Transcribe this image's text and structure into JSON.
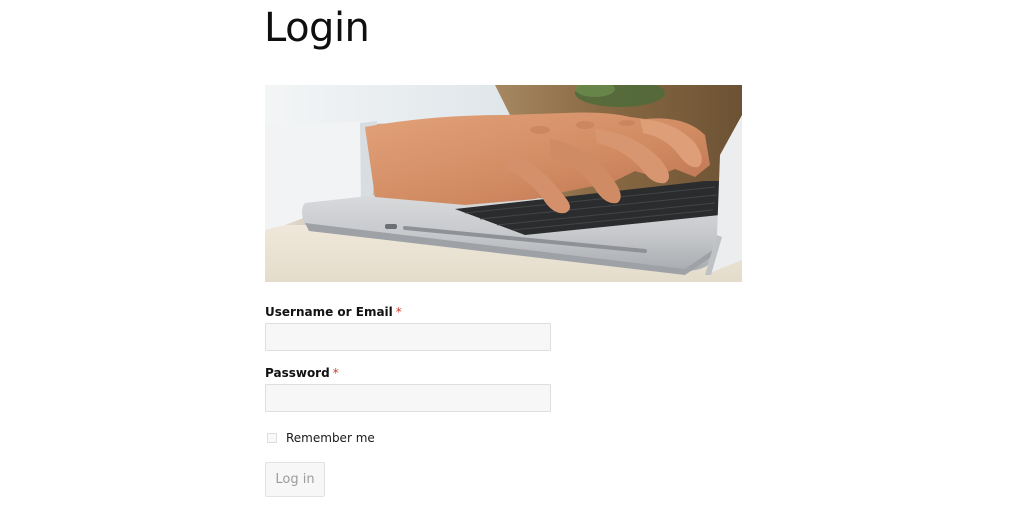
{
  "page": {
    "title": "Login"
  },
  "hero_image": {
    "icon": "laptop-typing-photo"
  },
  "form": {
    "username": {
      "label": "Username or Email",
      "required_mark": "*",
      "value": "",
      "placeholder": ""
    },
    "password": {
      "label": "Password",
      "required_mark": "*",
      "value": "",
      "placeholder": ""
    },
    "remember": {
      "label": "Remember me",
      "checked": false
    },
    "submit_label": "Log in"
  },
  "colors": {
    "required": "#d23a2a",
    "input_background": "#f6f7f6",
    "button_text": "#9c9c9c"
  }
}
